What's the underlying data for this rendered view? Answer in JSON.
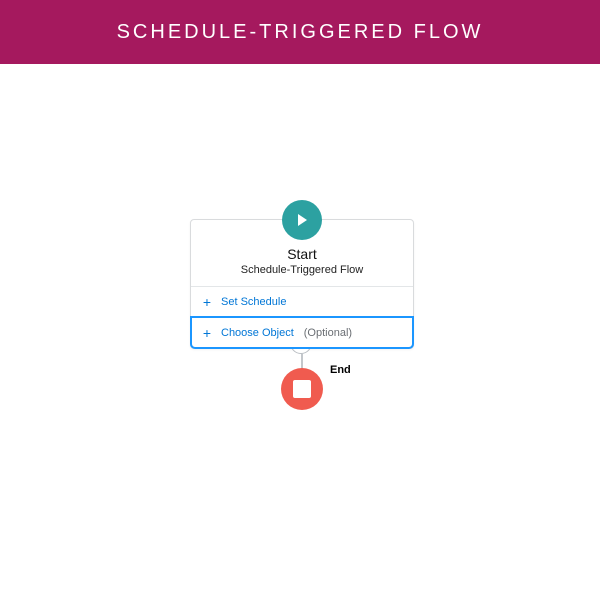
{
  "banner": {
    "title": "SCHEDULE-TRIGGERED FLOW"
  },
  "flow": {
    "start": {
      "title": "Start",
      "subtitle": "Schedule-Triggered Flow",
      "play_icon": "play-icon",
      "rows": {
        "schedule": {
          "label": "Set Schedule"
        },
        "object": {
          "label": "Choose Object",
          "optional": "(Optional)"
        }
      }
    },
    "add": {
      "symbol": "+"
    },
    "end": {
      "label": "End"
    }
  },
  "colors": {
    "banner_bg": "#a5195e",
    "play_bg": "#2ca1a1",
    "link": "#0076d6",
    "focus": "#1b96ff",
    "end_bg": "#f05b4f"
  }
}
